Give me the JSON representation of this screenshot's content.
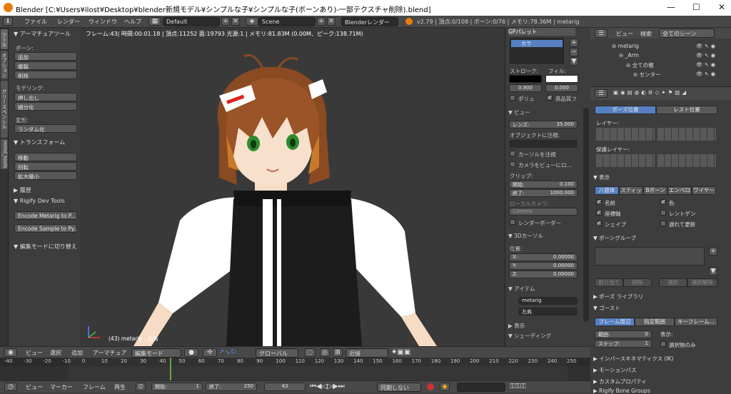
{
  "window": {
    "title": "Blender [C:¥Users¥ilost¥Desktop¥blender新規モデル¥シンプルな子¥シンプルな子(ボーンあり)-一部テクスチャ削除).blend]",
    "minimize": "—",
    "maximize": "☐",
    "close": "✕"
  },
  "topbar": {
    "menus": [
      "ファイル",
      "レンダー",
      "ウィンドウ",
      "ヘルプ"
    ],
    "layout": "Default",
    "scene": "Scene",
    "engine": "Blenderレンダー",
    "stats": "v2.79 | 頂点:0/108 | ボーン:0/76 | メモリ:78.36M | metarig"
  },
  "toolshelf": {
    "tabs": [
      "ツール",
      "オプション",
      "グリースペンシル",
      "mmd_tools"
    ],
    "armature_tools": "アーマチュアツール",
    "bone_label": "ボーン:",
    "bone_buttons": [
      "追加",
      "複製",
      "削除"
    ],
    "modeling_label": "モデリング:",
    "modeling_buttons": [
      "押し出し",
      "細分化"
    ],
    "deform_label": "変形:",
    "deform_buttons": [
      "ランダム化"
    ],
    "transform": "トランスフォーム",
    "transform_buttons": [
      "移動",
      "回転",
      "拡大縮小"
    ],
    "history": "履歴",
    "rigify": "Rigify Dev Tools",
    "rigify_buttons": [
      "Encode Metarig to P...",
      "Encode Sample to Py..."
    ],
    "toggle_edit": "編集モードに切り替え"
  },
  "viewport": {
    "info": "フレーム:43| 時間:00:01.18 | 頂点:11252 面:19793 光源:1 | メモリ:81.83M (0.00M、ピーク:138.71M)",
    "object_label": "(43) metarig : 左肩"
  },
  "npanel": {
    "gp_title": "GPパレット",
    "gp_color": "カラ",
    "stroke_label": "ストローク:",
    "fill_label": "フィル:",
    "stroke_value": "0.900",
    "fill_value": "0.000",
    "polygon": "ポリュ",
    "hq_fill": "高品質フ",
    "view": "ビュー",
    "lens_label": "レンズ:",
    "lens_value": "35.000",
    "lock_object": "オブジェクトに注視:",
    "lock_cursor": "カーソルを注視",
    "camera_to_view": "カメラをビューにロ...",
    "clip": "クリップ:",
    "clip_start_label": "開始:",
    "clip_start": "0.100",
    "clip_end_label": "終了:",
    "clip_end": "1000.000",
    "local_camera": "ローカルカメラ:",
    "camera": "Camera",
    "render_border": "レンダーボーダー",
    "cursor3d": "3Dカーソル",
    "location": "位置:",
    "x_label": "X:",
    "x_value": "0.00000",
    "y_label": "Y:",
    "y_value": "0.00000",
    "z_label": "Z:",
    "z_value": "0.00000",
    "item": "アイテム",
    "item_name": "metarig",
    "bone_name": "左肩",
    "display": "表示",
    "shading": "シェーディング"
  },
  "outliner": {
    "view": "ビュー",
    "search": "検索",
    "scenes": "全てのシーン",
    "rows": [
      "metarig",
      "_Arm",
      "全ての親",
      "センター"
    ]
  },
  "properties": {
    "pose_position": "ポーズ位置",
    "rest_position": "レスト位置",
    "layers": "レイヤー:",
    "protected_layers": "保護レイヤー:",
    "display": "表示",
    "display_tabs": [
      "八面体",
      "スティッ",
      "Bボーン",
      "エンベロ",
      "ワイヤー"
    ],
    "checks_left": [
      "名前",
      "座標軸",
      "シェイプ"
    ],
    "checks_right": [
      "色",
      "レントゲン",
      "遅れて更新"
    ],
    "bone_groups": "ボーングループ",
    "bg_buttons": [
      "割り当て",
      "削除",
      "選択",
      "選択解除"
    ],
    "pose_library": "ポーズ ライブラリ",
    "ghost": "ゴースト",
    "ghost_tabs": [
      "フレーム周辺",
      "指定範囲",
      "キーフレーム..."
    ],
    "range_label": "範囲:",
    "range_value": "0",
    "step_label": "ステップ:",
    "step_value": "1",
    "display_label": "表示:",
    "selected_only": "選択物のみ",
    "ik": "インバースキネマティクス (IK)",
    "motion_paths": "モーションパス",
    "custom_props": "カスタムプロパティ",
    "rigify_bone_groups": "Rigify Bone Groups"
  },
  "viewport_header": {
    "menus": [
      "ビュー",
      "選択",
      "追加",
      "アーマチュア"
    ],
    "mode": "編集モード",
    "orientation": "グローバル",
    "pivot": "近接"
  },
  "timeline": {
    "ticks": [
      "-40",
      "-30",
      "-20",
      "-10",
      "0",
      "10",
      "20",
      "30",
      "40",
      "50",
      "60",
      "70",
      "80",
      "90",
      "100",
      "110",
      "120",
      "130",
      "140",
      "150",
      "160",
      "170",
      "180",
      "190",
      "200",
      "210",
      "220",
      "230",
      "240",
      "250"
    ],
    "current_frame_fraction": 0.287
  },
  "timeline_header": {
    "menus": [
      "ビュー",
      "マーカー",
      "フレーム",
      "再生"
    ],
    "start_label": "開始:",
    "start": "1",
    "end_label": "終了:",
    "end": "250",
    "current": "43",
    "sync": "同期しない"
  },
  "colors": {
    "accent": "#5680c2",
    "blender_orange": "#e87d0d",
    "frame_line": "#6ba53c"
  }
}
